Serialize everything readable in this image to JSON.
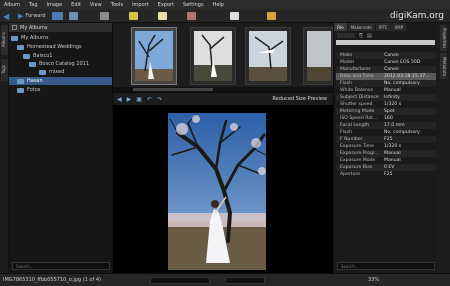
{
  "menubar": {
    "items": [
      "Album",
      "Tag",
      "Image",
      "Edit",
      "View",
      "Tools",
      "Import",
      "Export",
      "Settings",
      "Help"
    ]
  },
  "toolbar": {
    "forward_label": "Forward",
    "app_title": "digiKam.org"
  },
  "left_strip": {
    "tabs": [
      "Albums",
      "Tags"
    ]
  },
  "album_tree": {
    "header": "My Albums",
    "nodes": [
      {
        "label": "My Albums",
        "level": 0
      },
      {
        "label": "Homestead Weddings",
        "level": 1
      },
      {
        "label": "Baisco1",
        "level": 2
      },
      {
        "label": "Bosco Catalog 2011",
        "level": 3
      },
      {
        "label": "mixed",
        "level": 4
      },
      {
        "label": "Hasan",
        "level": 1,
        "selected": true
      },
      {
        "label": "Fotos",
        "level": 1
      }
    ],
    "search_placeholder": "Search..."
  },
  "preview": {
    "filename": "Reduced Size Preview"
  },
  "right_panel": {
    "tabs": [
      "File",
      "Makernote",
      "IPTC",
      "XMP"
    ],
    "metadata": [
      {
        "k": "Make",
        "v": "Canon"
      },
      {
        "k": "Model",
        "v": "Canon EOS 50D"
      },
      {
        "k": "Manufacturer",
        "v": "Canon"
      },
      {
        "k": "Date and Time",
        "v": "2012:03:18 15:37..."
      },
      {
        "k": "Flash",
        "v": "No, compulsory"
      },
      {
        "k": "White Balance",
        "v": "Manual"
      },
      {
        "k": "Subject Distance",
        "v": "Infinity"
      },
      {
        "k": "Shutter speed",
        "v": "1/320 s"
      },
      {
        "k": "Metering Mode",
        "v": "Spot"
      },
      {
        "k": "ISO Speed Rat...",
        "v": "160"
      },
      {
        "k": "Focal Length",
        "v": "17.0 mm"
      },
      {
        "k": "Flash",
        "v": "No, compulsory"
      },
      {
        "k": "F Number",
        "v": "F25"
      },
      {
        "k": "Exposure Time",
        "v": "1/320 s"
      },
      {
        "k": "Exposure Progr...",
        "v": "Manual"
      },
      {
        "k": "Exposure Mode",
        "v": "Manual"
      },
      {
        "k": "Exposure Bias",
        "v": "0 EV"
      },
      {
        "k": "Aperture",
        "v": "F25"
      }
    ],
    "search_placeholder": "Search..."
  },
  "right_strip": {
    "tabs": [
      "Properties",
      "Metadata"
    ]
  },
  "status": {
    "text": "IMG7865310_ffbb055710_o.jpg (1 of 4)",
    "zoom": "33%"
  }
}
